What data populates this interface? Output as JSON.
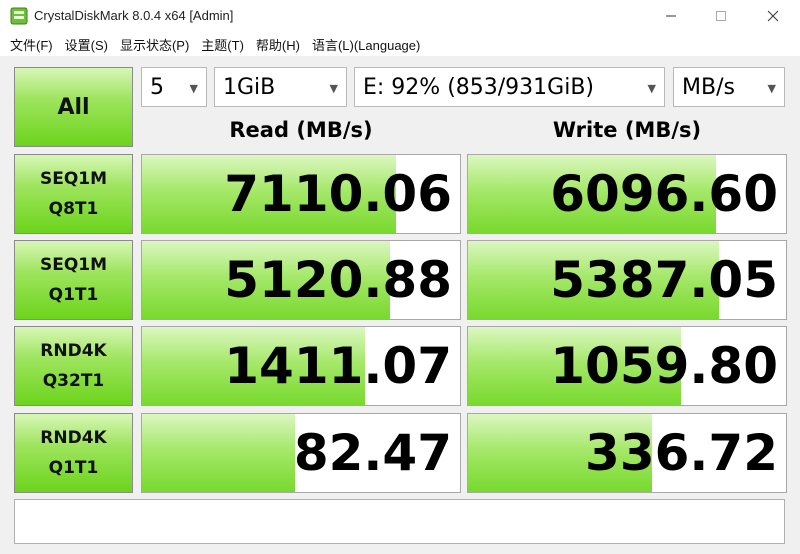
{
  "window": {
    "title": "CrystalDiskMark 8.0.4 x64 [Admin]",
    "min_icon": "minimize-icon",
    "max_icon": "maximize-icon",
    "close_icon": "close-icon"
  },
  "menu": [
    "文件(F)",
    "设置(S)",
    "显示状态(P)",
    "主题(T)",
    "帮助(H)",
    "语言(L)(Language)"
  ],
  "controls": {
    "all_label": "All",
    "count": "5",
    "size": "1GiB",
    "drive": "E: 92% (853/931GiB)",
    "unit": "MB/s"
  },
  "headers": {
    "read": "Read (MB/s)",
    "write": "Write (MB/s)"
  },
  "tests": [
    {
      "line1": "SEQ1M",
      "line2": "Q8T1",
      "read": "7110.06",
      "write": "6096.60"
    },
    {
      "line1": "SEQ1M",
      "line2": "Q1T1",
      "read": "5120.88",
      "write": "5387.05"
    },
    {
      "line1": "RND4K",
      "line2": "Q32T1",
      "read": "1411.07",
      "write": "1059.80"
    },
    {
      "line1": "RND4K",
      "line2": "Q1T1",
      "read": "82.47",
      "write": "336.72"
    }
  ],
  "bar_fill": {
    "read": [
      0.8,
      0.78,
      0.7,
      0.48
    ],
    "write": [
      0.78,
      0.79,
      0.67,
      0.58
    ]
  },
  "status_text": "",
  "colors": {
    "accent_green": "#78d92d",
    "title_bg": "#ffffff",
    "window_bg": "#f0f0f0"
  }
}
